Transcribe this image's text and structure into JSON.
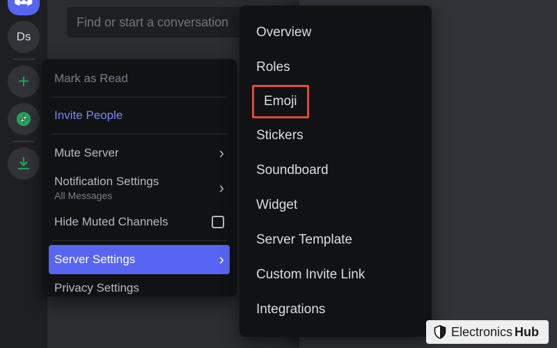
{
  "rail": {
    "ds_label": "Ds"
  },
  "search": {
    "placeholder": "Find or start a conversation"
  },
  "context_menu": {
    "mark_read": "Mark as Read",
    "invite": "Invite People",
    "mute": "Mute Server",
    "notif": "Notification Settings",
    "notif_sub": "All Messages",
    "hide_muted": "Hide Muted Channels",
    "server_settings": "Server Settings",
    "privacy": "Privacy Settings"
  },
  "sub_menu": {
    "items": {
      "overview": "Overview",
      "roles": "Roles",
      "emoji": "Emoji",
      "stickers": "Stickers",
      "soundboard": "Soundboard",
      "widget": "Widget",
      "server_template": "Server Template",
      "custom_invite": "Custom Invite Link",
      "integrations": "Integrations"
    }
  },
  "watermark": {
    "brand1": "Electronics",
    "brand2": "Hub"
  }
}
